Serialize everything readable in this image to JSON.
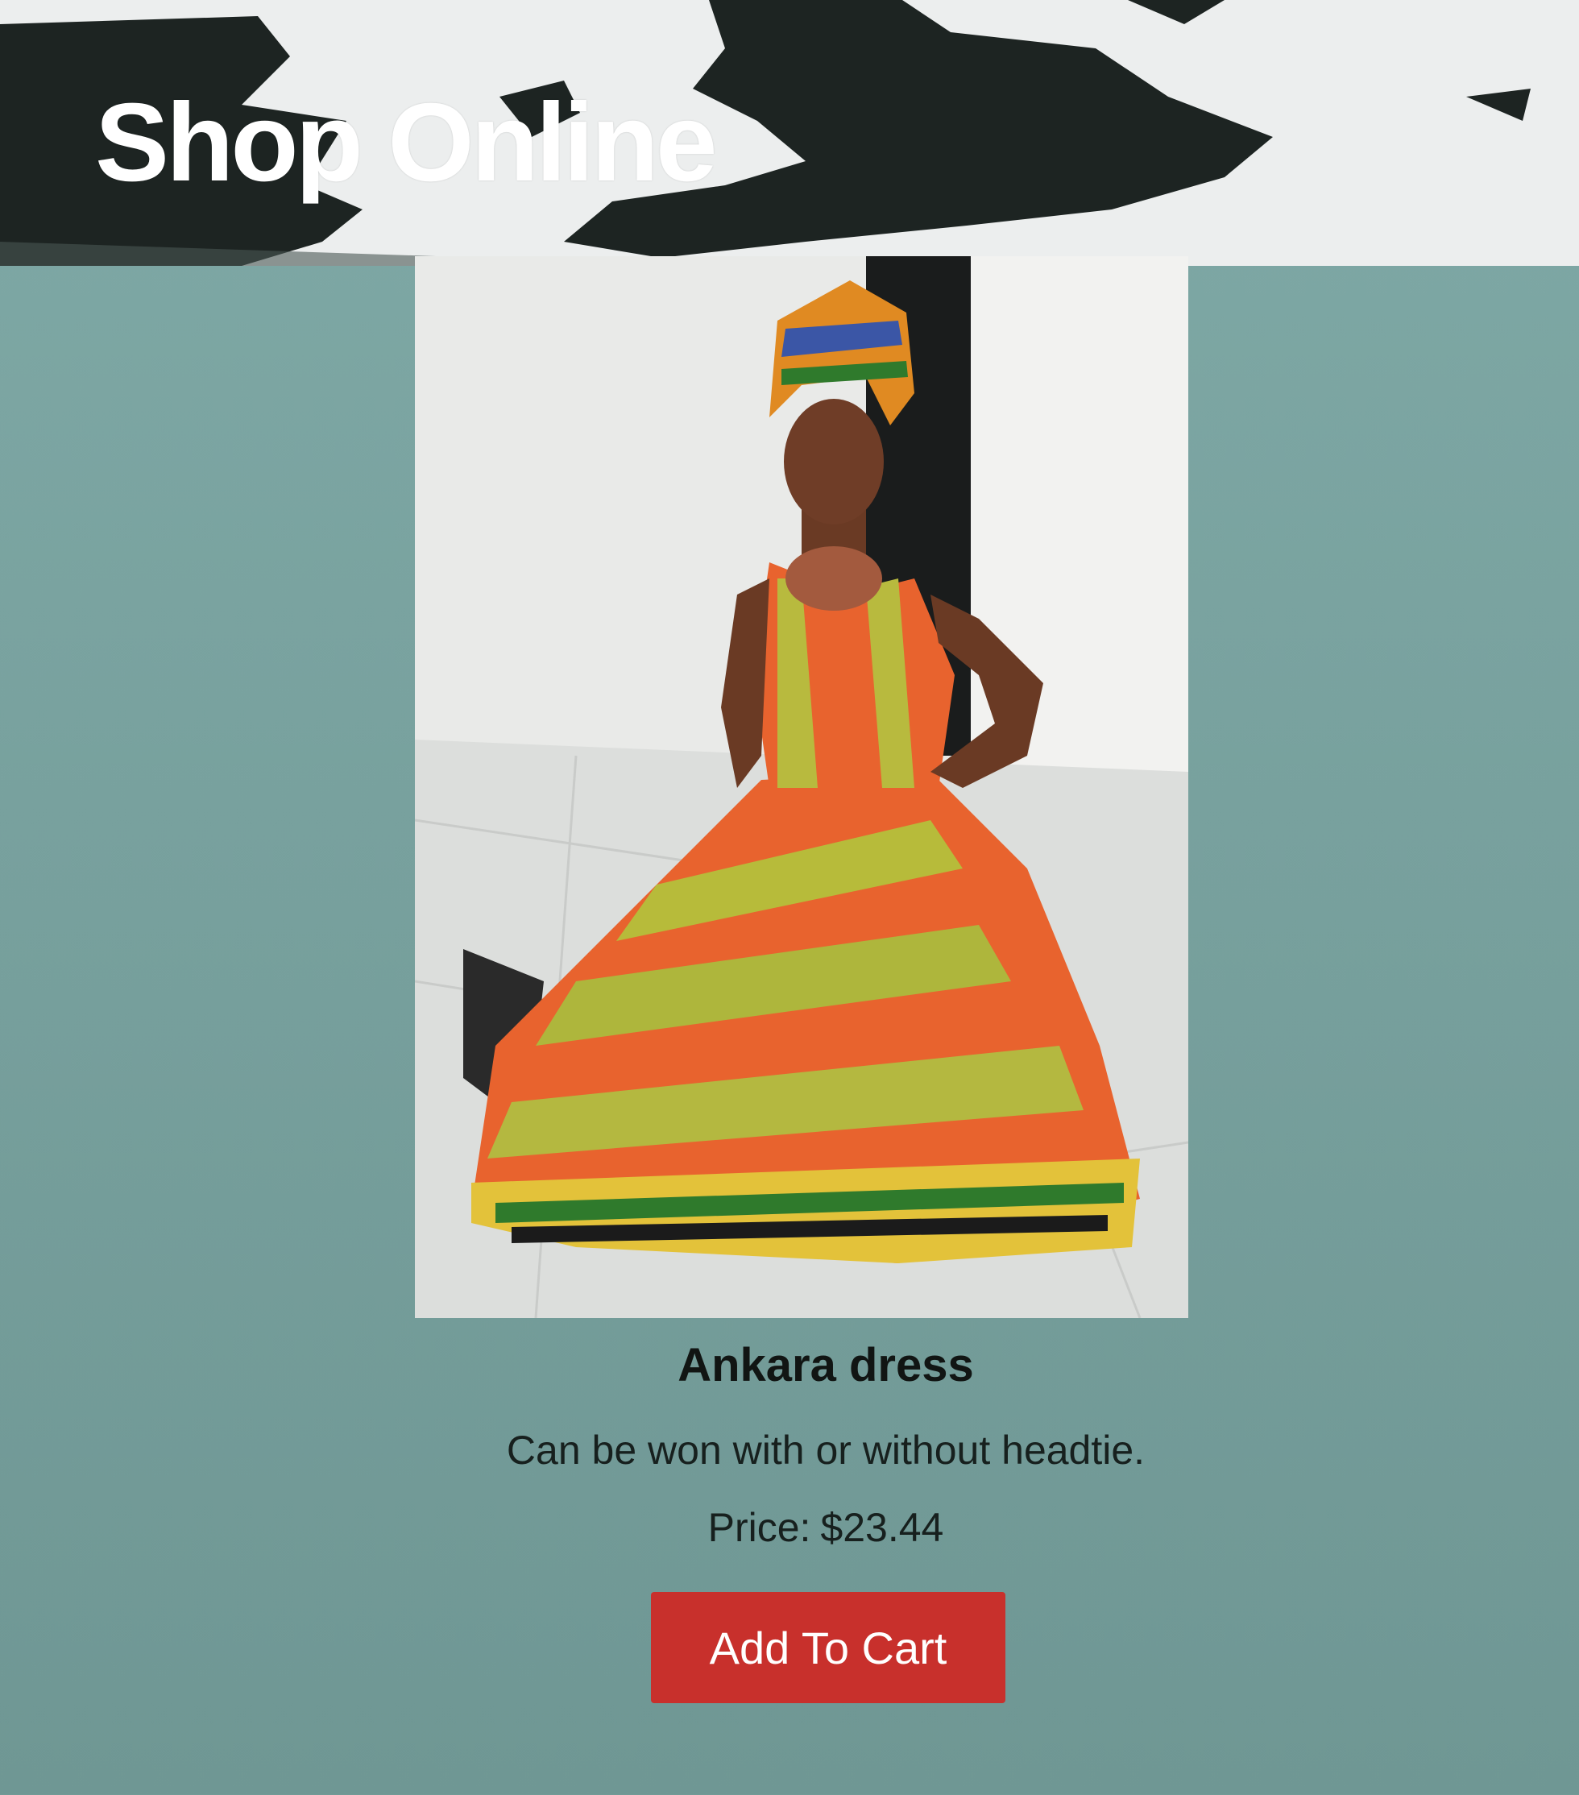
{
  "banner": {
    "title": "Shop Online"
  },
  "product": {
    "image_alt": "Woman in orange and kente-print Ankara dress with headtie",
    "name": "Ankara dress",
    "description": "Can be won with or without headtie.",
    "price_label": "Price:",
    "price_value": "$23.44",
    "add_to_cart_label": "Add To Cart"
  },
  "colors": {
    "page_background": "#7fa9a6",
    "button_background": "#c8302c",
    "button_text": "#ffffff",
    "banner_brush": "#1d2422"
  }
}
